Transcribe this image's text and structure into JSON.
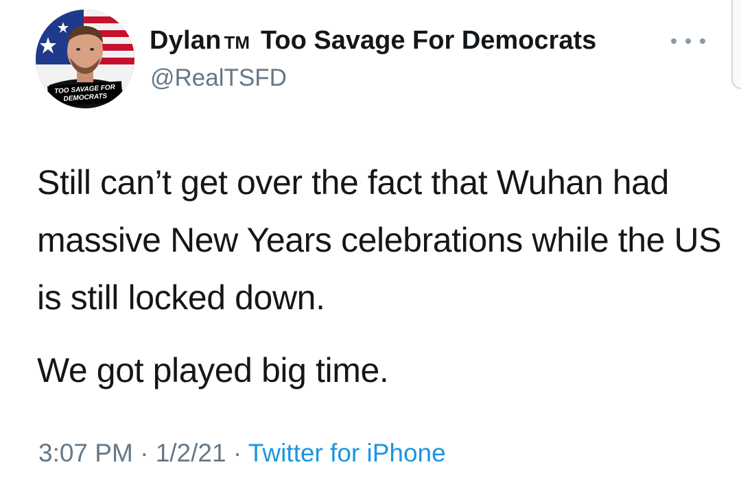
{
  "author": {
    "display_name": "Dylan",
    "tm": "TM",
    "display_name_rest": "Too Savage For Democrats",
    "handle": "@RealTSFD",
    "avatar_text_line1": "TOO SAVAGE FOR",
    "avatar_text_line2": "DEMOCRATS"
  },
  "tweet": {
    "paragraph1": "Still can’t get over the fact that Wuhan had massive New Years celebrations while the US is still locked down.",
    "paragraph2": "We got played big time.",
    "time": "3:07 PM",
    "separator": "·",
    "date": "1/2/21",
    "source": "Twitter for iPhone"
  },
  "icons": {
    "more": "more-horizontal-icon"
  },
  "colors": {
    "text": "#14171a",
    "secondary": "#657786",
    "link": "#1b95e0"
  }
}
